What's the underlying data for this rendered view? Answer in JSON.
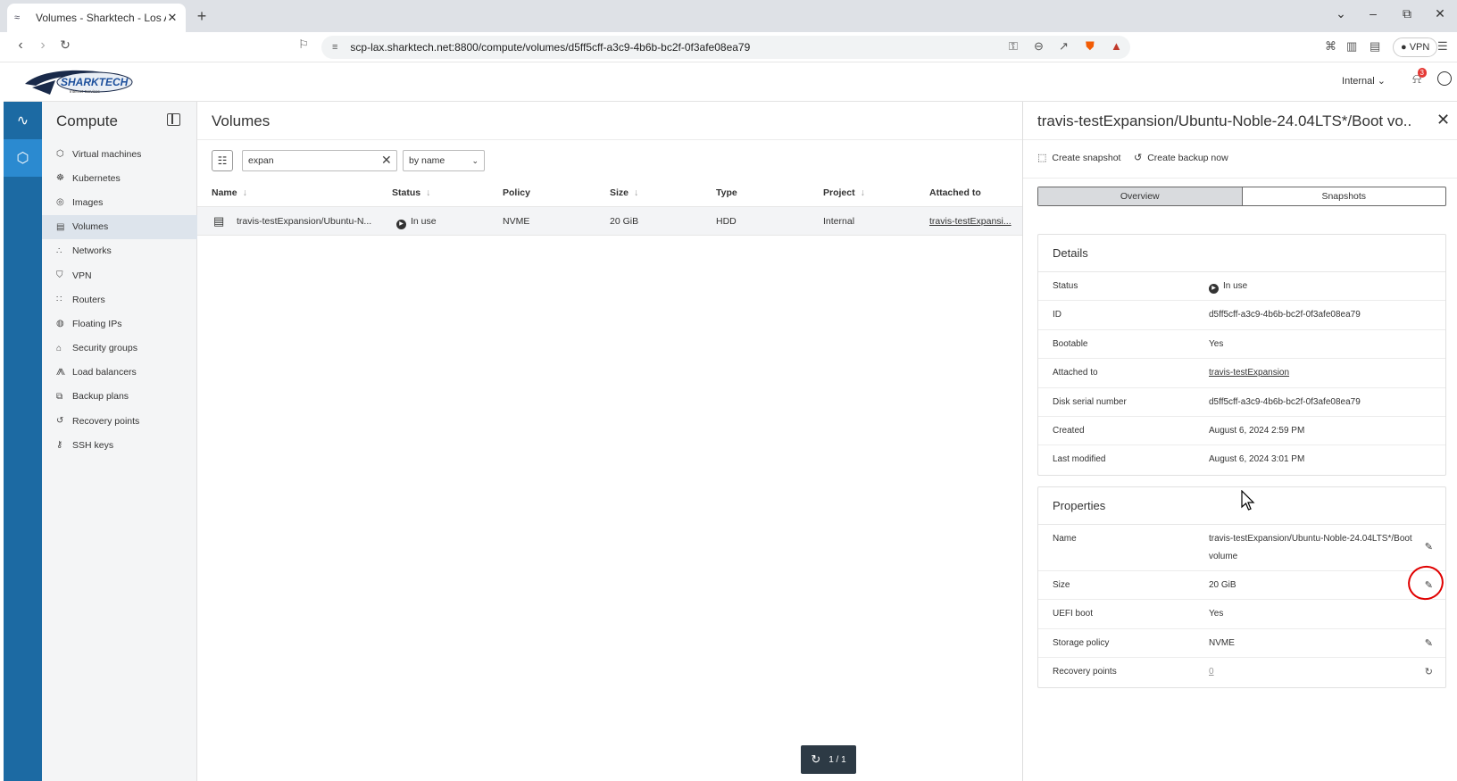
{
  "browser": {
    "tab_title": "Volumes - Sharktech - Los Ange",
    "url": "scp-lax.sharktech.net:8800/compute/volumes/d5ff5cff-a3c9-4b6b-bc2f-0f3afe08ea79",
    "vpn_label": "VPN"
  },
  "header": {
    "logo_text": "SHARKTECH",
    "logo_sub": "Internet Services",
    "project": "Internal",
    "notifications": "3"
  },
  "sidebar": {
    "title": "Compute",
    "items": [
      {
        "label": "Virtual machines",
        "icon": "cube-icon"
      },
      {
        "label": "Kubernetes",
        "icon": "helm-icon"
      },
      {
        "label": "Images",
        "icon": "disc-icon"
      },
      {
        "label": "Volumes",
        "icon": "drive-icon"
      },
      {
        "label": "Networks",
        "icon": "network-icon"
      },
      {
        "label": "VPN",
        "icon": "shield-icon"
      },
      {
        "label": "Routers",
        "icon": "router-icon"
      },
      {
        "label": "Floating IPs",
        "icon": "globe-icon"
      },
      {
        "label": "Security groups",
        "icon": "lock-icon"
      },
      {
        "label": "Load balancers",
        "icon": "hierarchy-icon"
      },
      {
        "label": "Backup plans",
        "icon": "backup-icon"
      },
      {
        "label": "Recovery points",
        "icon": "restore-icon"
      },
      {
        "label": "SSH keys",
        "icon": "key-icon"
      }
    ]
  },
  "main": {
    "title": "Volumes",
    "search_value": "expan",
    "sort_label": "by name",
    "columns": [
      "Name",
      "Status",
      "Policy",
      "Size",
      "Type",
      "Project",
      "Attached to"
    ],
    "row": {
      "name": "travis-testExpansion/Ubuntu-N...",
      "status": "In use",
      "policy": "NVME",
      "size": "20 GiB",
      "type": "HDD",
      "project": "Internal",
      "attached": "travis-testExpansi..."
    },
    "pager": "1 / 1"
  },
  "panel": {
    "title": "travis-testExpansion/Ubuntu-Noble-24.04LTS*/Boot vo...",
    "create_snapshot": "Create snapshot",
    "create_backup": "Create backup now",
    "tab_overview": "Overview",
    "tab_snapshots": "Snapshots",
    "details": {
      "title": "Details",
      "status_label": "Status",
      "status_value": "In use",
      "id_label": "ID",
      "id_value": "d5ff5cff-a3c9-4b6b-bc2f-0f3afe08ea79",
      "bootable_label": "Bootable",
      "bootable_value": "Yes",
      "attached_label": "Attached to",
      "attached_value": "travis-testExpansion",
      "serial_label": "Disk serial number",
      "serial_value": "d5ff5cff-a3c9-4b6b-bc2f-0f3afe08ea79",
      "created_label": "Created",
      "created_value": "August 6, 2024 2:59 PM",
      "modified_label": "Last modified",
      "modified_value": "August 6, 2024 3:01 PM"
    },
    "properties": {
      "title": "Properties",
      "name_label": "Name",
      "name_value": "travis-testExpansion/Ubuntu-Noble-24.04LTS*/Boot volume",
      "size_label": "Size",
      "size_value": "20 GiB",
      "uefi_label": "UEFI boot",
      "uefi_value": "Yes",
      "policy_label": "Storage policy",
      "policy_value": "NVME",
      "recovery_label": "Recovery points",
      "recovery_value": "0"
    }
  }
}
